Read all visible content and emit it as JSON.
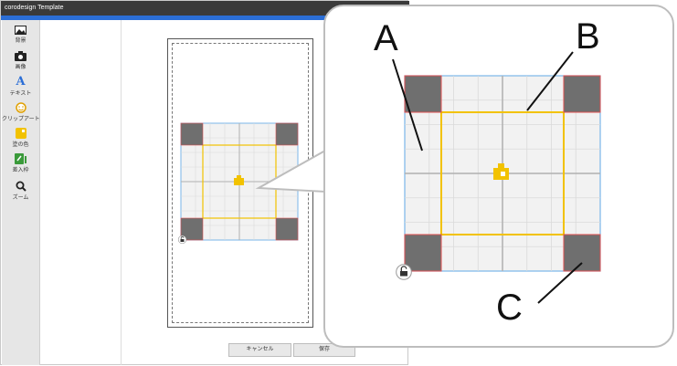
{
  "window": {
    "title": "corodesign Template"
  },
  "toolbar": {
    "items": [
      {
        "label": "背景",
        "icon": "image-icon"
      },
      {
        "label": "画像",
        "icon": "camera-icon"
      },
      {
        "label": "テキスト",
        "icon": "text-A-icon"
      },
      {
        "label": "クリップアート",
        "icon": "smiley-icon"
      },
      {
        "label": "塗の色",
        "icon": "color-fill-icon"
      },
      {
        "label": "差入枠",
        "icon": "insert-frame-icon"
      },
      {
        "label": "ズーム",
        "icon": "magnifier-icon"
      }
    ]
  },
  "buttons": {
    "cancel": "キャンセル",
    "save": "保存"
  },
  "callout_labels": {
    "a": "A",
    "b": "B",
    "c": "C"
  },
  "colors": {
    "frame_yellow": "#f2c200",
    "guide_blue": "#7ab6e8",
    "corner_gray": "#6f6f6f",
    "corner_red": "#e05050",
    "title_dark": "#3a3a3a",
    "accent_blue": "#2b6ed6"
  }
}
